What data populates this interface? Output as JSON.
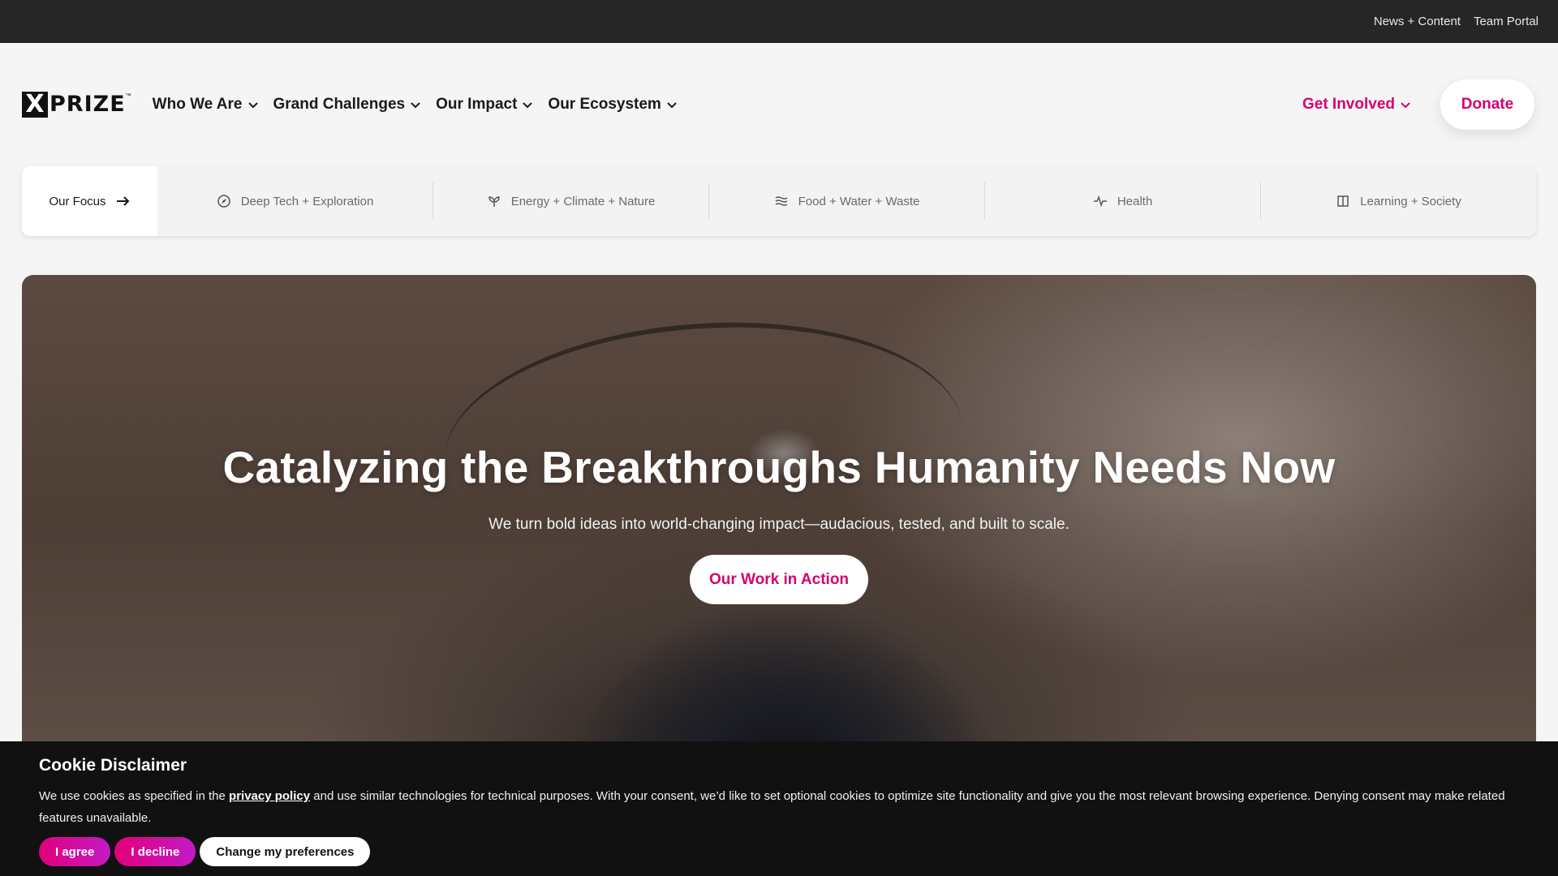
{
  "topbar": {
    "links": [
      "News + Content",
      "Team Portal"
    ]
  },
  "logo": {
    "mark": "X",
    "word": "PRIZE",
    "tm": "™"
  },
  "nav": {
    "items": [
      {
        "label": "Who We Are"
      },
      {
        "label": "Grand Challenges"
      },
      {
        "label": "Our Impact"
      },
      {
        "label": "Our Ecosystem"
      }
    ],
    "get_involved": "Get Involved",
    "donate": "Donate"
  },
  "focus": {
    "label": "Our Focus",
    "items": [
      {
        "label": "Deep Tech + Exploration",
        "icon": "compass-icon"
      },
      {
        "label": "Energy + Climate + Nature",
        "icon": "leaf-icon"
      },
      {
        "label": "Food + Water + Waste",
        "icon": "waves-icon"
      },
      {
        "label": "Health",
        "icon": "pulse-icon"
      },
      {
        "label": "Learning + Society",
        "icon": "book-icon"
      }
    ]
  },
  "hero": {
    "title": "Catalyzing the Breakthroughs Humanity Needs Now",
    "subtitle": "We turn bold ideas into world-changing impact—audacious, tested, and built to scale.",
    "cta": "Our Work in Action"
  },
  "cookie": {
    "title": "Cookie Disclaimer",
    "text_before": "We use cookies as specified in the ",
    "link": "privacy policy",
    "text_after": " and use similar technologies for technical purposes. With your consent, we’d like to set optional cookies to optimize site functionality and give you the most relevant browsing experience. Denying consent may make related features unavailable.",
    "agree": "I agree",
    "decline": "I decline",
    "prefs": "Change my preferences"
  },
  "colors": {
    "accent": "#d6006f",
    "topbar": "#262626",
    "cookie_bg": "#111111"
  }
}
